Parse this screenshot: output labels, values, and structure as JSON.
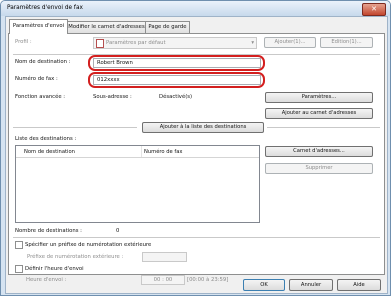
{
  "window": {
    "title": "Paramètres d'envoi de fax",
    "close_symbol": "✕"
  },
  "tabs": [
    {
      "label": "Paramètres d'envoi"
    },
    {
      "label": "Modifier le carnet d'adresses"
    },
    {
      "label": "Page de garde"
    }
  ],
  "profile": {
    "label": "Profil :",
    "value": "Paramètres par défaut",
    "add_button": "Ajouter(1)...",
    "edit_button": "Edition(1)..."
  },
  "recipient": {
    "name_label": "Nom de destination :",
    "name_value": "Robert Brown",
    "fax_label": "Numéro de fax :",
    "fax_value": "012xxxx",
    "advanced_label": "Fonction avancée :",
    "subaddress_label": "Sous-adresse :",
    "subaddress_value": "Désactivé(s)",
    "settings_button": "Paramètres...",
    "add_to_addressbook_button": "Ajouter au carnet d'adresses",
    "add_to_list_button": "Ajouter à la liste des destinations"
  },
  "destination_list": {
    "label": "Liste des destinations :",
    "columns": [
      "Nom de destination",
      "Numéro de fax"
    ],
    "addressbook_button": "Carnet d'adresses...",
    "delete_button": "Supprimer",
    "count_label": "Nombre de destinations :",
    "count_value": "0"
  },
  "dialing_prefix": {
    "checkbox_label": "Spécifier un préfixe de numérotation extérieure",
    "field_label": "Préfixe de numérotation extérieure :"
  },
  "send_time": {
    "checkbox_label": "Définir l'heure d'envoi",
    "field_label": "Heure d'envoi :",
    "value": "00 : 00",
    "range": "[00:00 à 23:59]"
  },
  "footer": {
    "ok": "OK",
    "cancel": "Annuler",
    "help": "Aide"
  },
  "colors": {
    "highlight": "#d31f1f",
    "title_bar": "#c7d9ec",
    "close_button": "#c2462e"
  },
  "icons": {
    "profile": "fax-profile-icon",
    "dropdown": "chevron-down-icon",
    "close": "close-icon"
  }
}
